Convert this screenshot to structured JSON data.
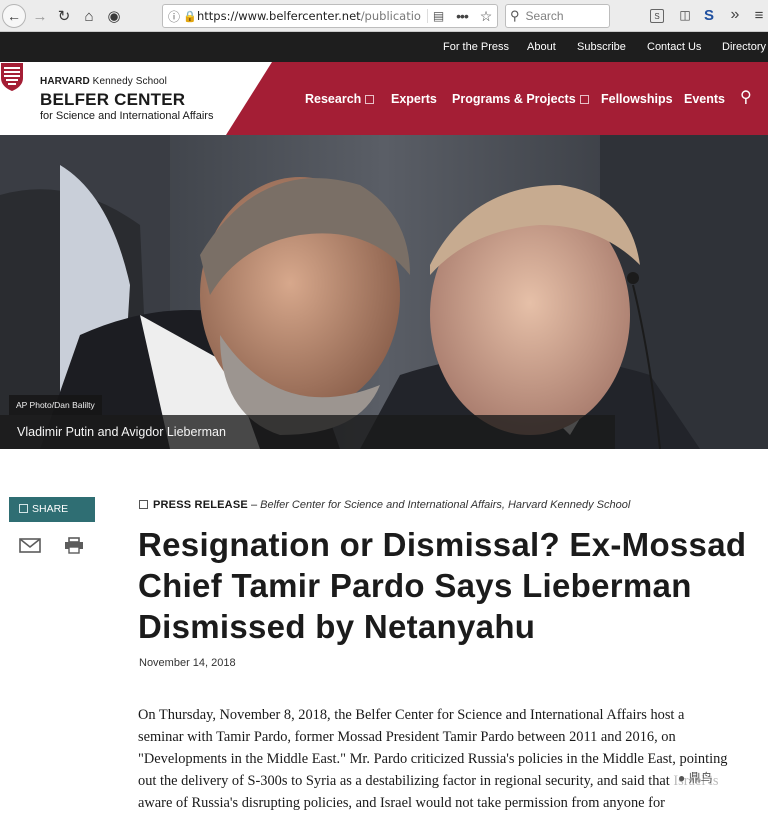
{
  "browser": {
    "url_host": "https://www.belfercenter.net",
    "url_path": "/publicatio",
    "search_placeholder": "Search",
    "toolbar_icons": [
      "back-icon",
      "forward-icon",
      "reload-icon",
      "home-icon",
      "pocket-icon",
      "info-icon",
      "lock-icon",
      "reader-icon",
      "more-icon",
      "star-icon",
      "search-icon",
      "screenshot-icon",
      "sidebar-icon",
      "extension-icon",
      "overflow-icon"
    ]
  },
  "utility_nav": [
    "For the Press",
    "About",
    "Subscribe",
    "Contact Us",
    "Directory"
  ],
  "header": {
    "school": "HARVARD",
    "school_rest": "Kennedy School",
    "center": "BELFER CENTER",
    "subtitle": "for Science and International Affairs",
    "nav": [
      "Research",
      "Experts",
      "Programs & Projects",
      "Fellowships",
      "Events"
    ],
    "brand_color": "#a41e35"
  },
  "hero": {
    "credit": "AP Photo/Dan Balilty",
    "caption": "Vladimir Putin and Avigdor Lieberman"
  },
  "sidebar": {
    "share_label": "SHARE",
    "share_color": "#2f6e73"
  },
  "article": {
    "type_label": "PRESS RELEASE",
    "separator": " – ",
    "source": "Belfer Center for Science and International Affairs, Harvard Kennedy School",
    "title_lines": [
      "Resignation or Dismissal? Ex-Mossad",
      "Chief Tamir Pardo Says Lieberman",
      "Dismissed by Netanyahu"
    ],
    "date": "November 14, 2018",
    "body_lines": [
      "On Thursday, November 8, 2018, the Belfer Center for Science and International Affairs host a",
      "seminar with Tamir Pardo, former Mossad President Tamir Pardo between 2011 and 2016, on",
      "\"Developments in the Middle East.\" Mr. Pardo criticized Russia's policies in the Middle East, pointing",
      "out the delivery of S-300s to Syria as a destabilizing factor in regional security, and said that Israel is",
      "aware of Russia's disrupting policies, and Israel would not take permission from anyone for"
    ]
  },
  "overlay": {
    "watermark": "鼎鸟"
  }
}
